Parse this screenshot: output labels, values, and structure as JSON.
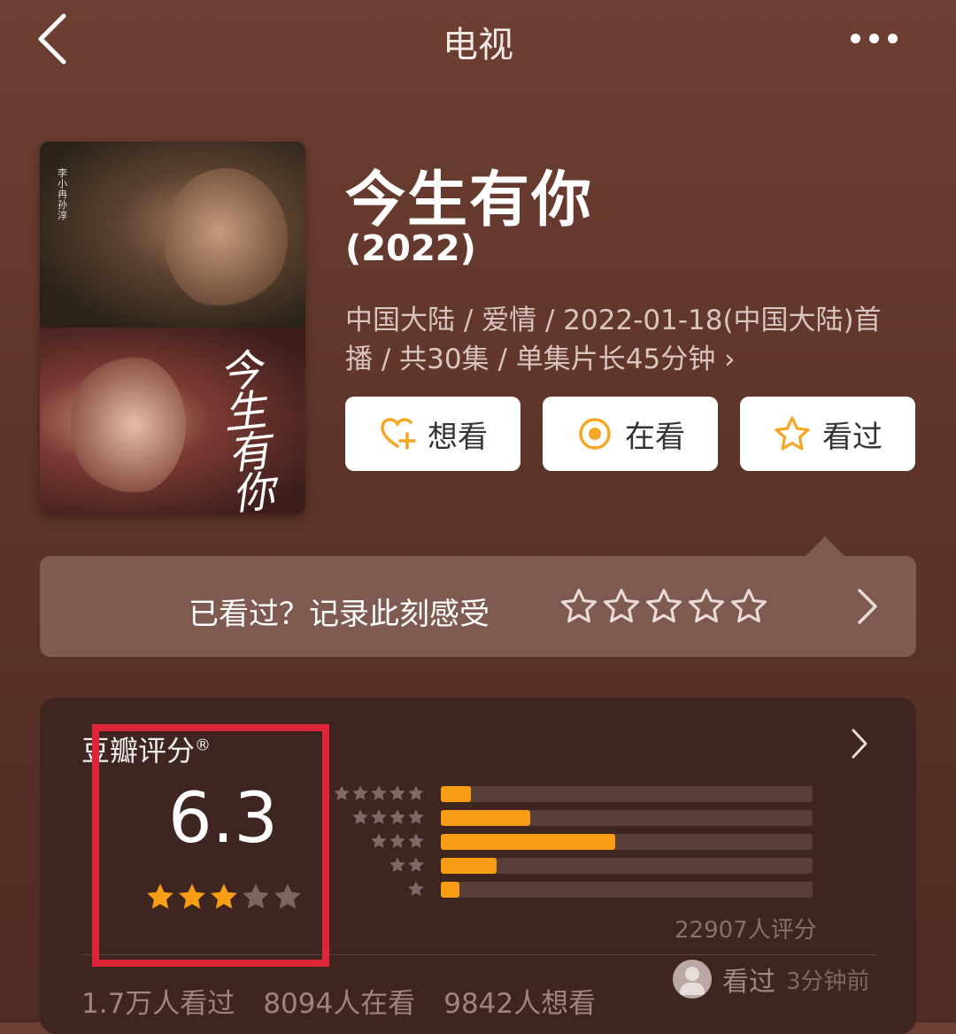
{
  "header": {
    "title": "电视",
    "back_icon": "chevron-left-icon",
    "more_icon": "more-dots-icon"
  },
  "poster": {
    "calligraphy": "今生有你",
    "vertical_text": "李小冉 孙淳"
  },
  "show": {
    "name": "今生有你",
    "year": "(2022)",
    "meta_line1": "中国大陆 / 爱情 / 2022-01-18(中国大陆)首",
    "meta_line2": "播 / 共30集 / 单集片长45分钟",
    "meta_chevron": "›"
  },
  "actions": [
    {
      "label": "想看",
      "icon": "heart-plus-icon"
    },
    {
      "label": "在看",
      "icon": "target-icon"
    },
    {
      "label": "看过",
      "icon": "star-outline-icon"
    }
  ],
  "record": {
    "prompt": "已看过？记录此刻感受",
    "star_count": 5
  },
  "rating": {
    "title": "豆瓣评分",
    "title_mark": "®",
    "score": "6.3",
    "stars_filled": 3,
    "stars_total": 5,
    "distribution": [
      {
        "stars": 5,
        "fraction": 0.08
      },
      {
        "stars": 4,
        "fraction": 0.24
      },
      {
        "stars": 3,
        "fraction": 0.47
      },
      {
        "stars": 2,
        "fraction": 0.15
      },
      {
        "stars": 1,
        "fraction": 0.05
      }
    ],
    "count_text": "22907人评分",
    "stats": [
      "1.7万人看过",
      "8094人在看",
      "9842人想看"
    ],
    "friend_status": "看过",
    "friend_time": "3分钟前"
  },
  "colors": {
    "accent": "#f99d14",
    "highlight": "#e0243a",
    "background": "#6e3f33"
  }
}
